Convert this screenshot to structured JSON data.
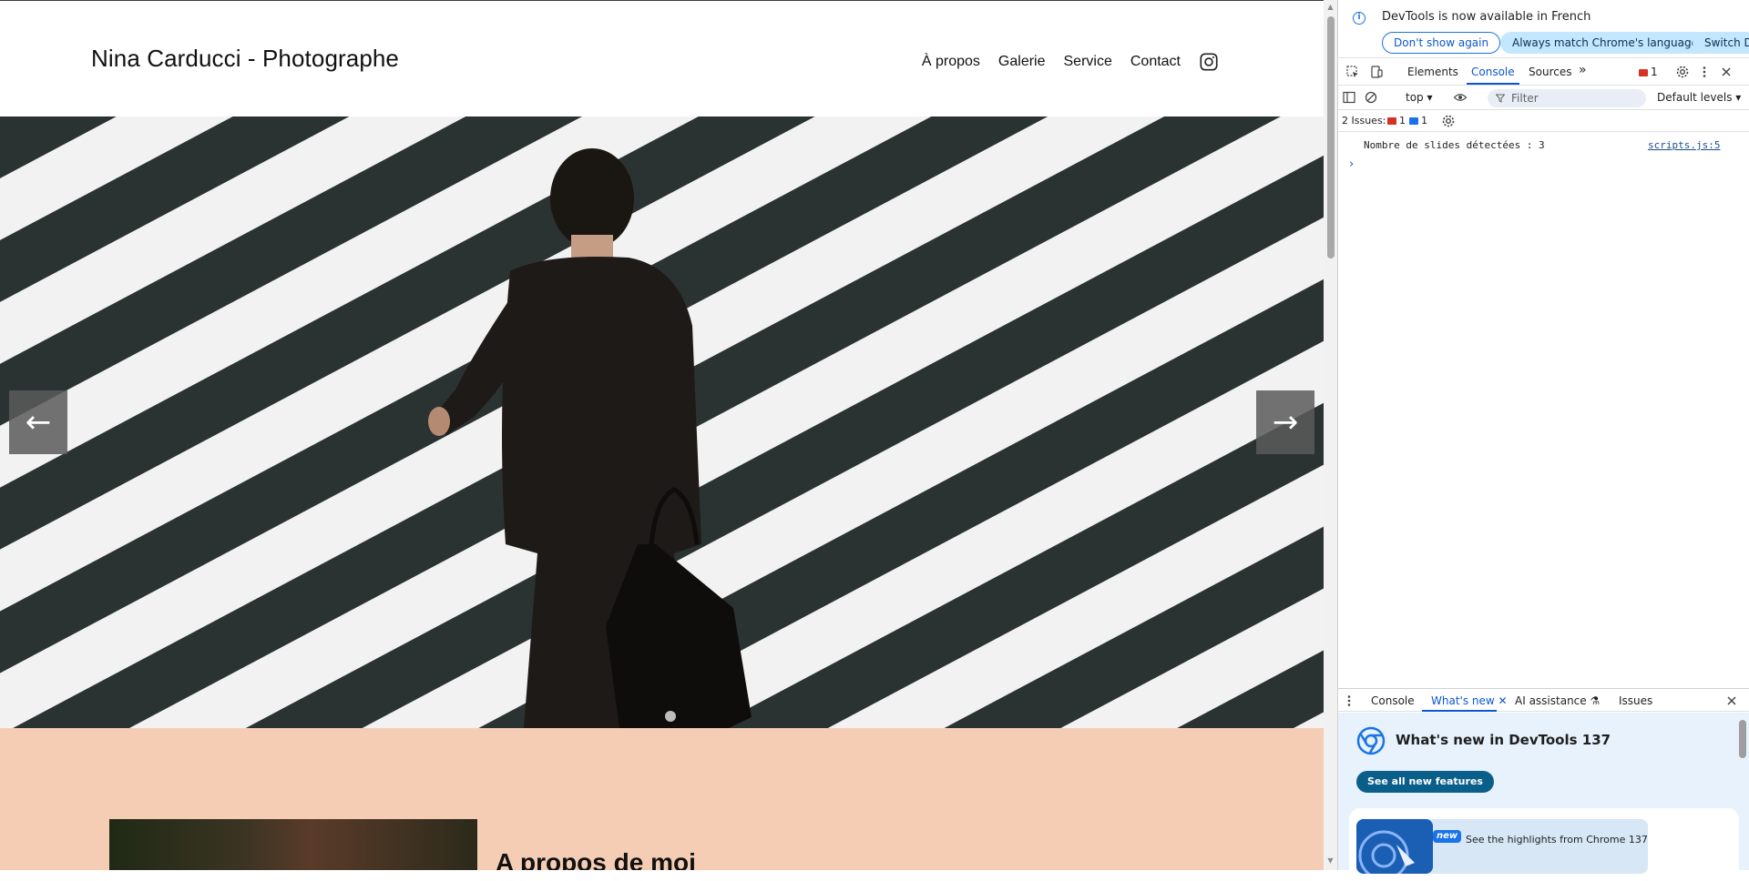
{
  "site": {
    "title": "Nina Carducci - Photographe",
    "nav": [
      "À propos",
      "Galerie",
      "Service",
      "Contact"
    ],
    "instagram_icon": "instagram-icon",
    "carousel": {
      "prev_label": "←",
      "next_label": "→",
      "dot_count": 1
    },
    "about_title": "A propos de moi",
    "colors": {
      "about_bg": "#f5cdb4",
      "arrow_bg": "#5a5a5a"
    }
  },
  "devtools": {
    "language_bar": {
      "message": "DevTools is now available in French",
      "buttons": [
        "Don't show again",
        "Always match Chrome's language",
        "Switch DevTools to French"
      ]
    },
    "tabs": [
      "Elements",
      "Console",
      "Sources"
    ],
    "active_tab": "Console",
    "error_count": "1",
    "console_bar": {
      "context": "top",
      "filter_placeholder": "Filter",
      "levels": "Default levels"
    },
    "issues": {
      "label": "2 Issues:",
      "errors": "1",
      "info": "1"
    },
    "log": {
      "message": "Nombre de slides détectées : 3",
      "source": "scripts.js:5"
    },
    "drawer": {
      "tabs": [
        "Console",
        "What's new",
        "AI assistance",
        "Issues"
      ],
      "active_tab": "What's new",
      "whats_new_title": "What's new in DevTools 137",
      "see_all_label": "See all new features",
      "new_badge": "new",
      "highlight_text": "See the highlights from Chrome 137"
    }
  }
}
